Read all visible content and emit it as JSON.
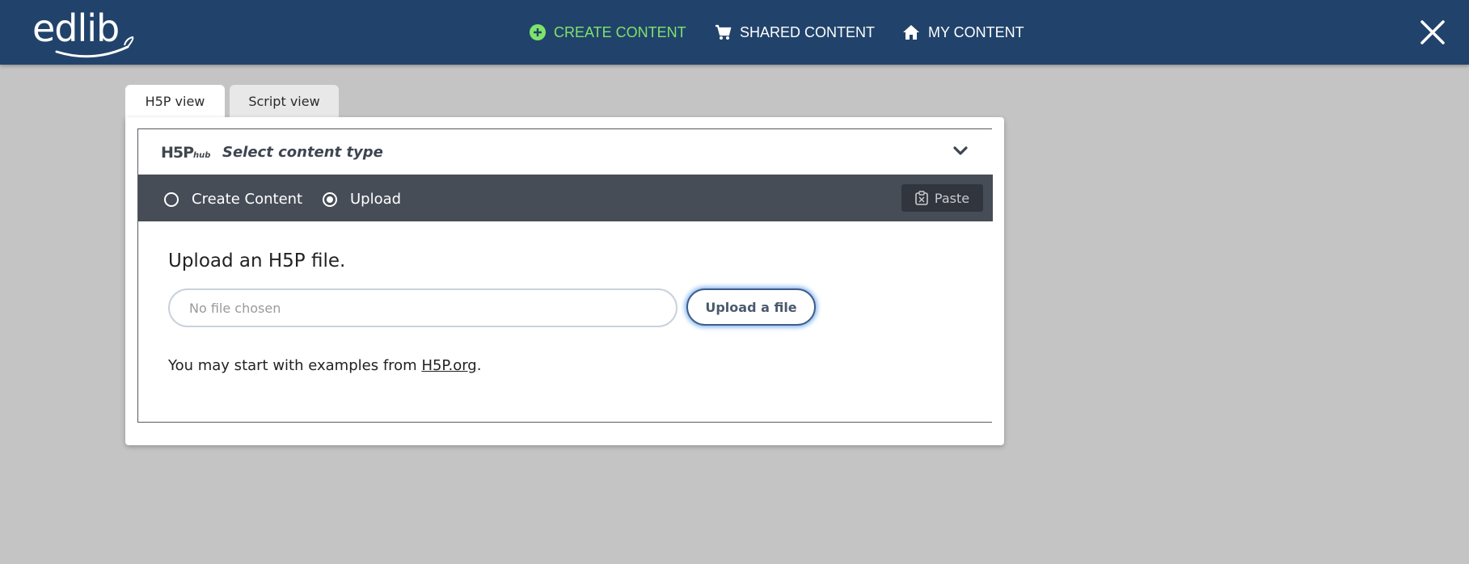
{
  "topbar": {
    "logo_text": "edlib",
    "nav": [
      {
        "label": "CREATE CONTENT",
        "icon": "plus-circle-icon",
        "color": "#7ee36b"
      },
      {
        "label": "SHARED CONTENT",
        "icon": "cart-icon",
        "color": "#ffffff"
      },
      {
        "label": "MY CONTENT",
        "icon": "home-icon",
        "color": "#ffffff"
      }
    ],
    "close_icon": "close-icon",
    "background": "#21436b"
  },
  "tabs": [
    {
      "label": "H5P view",
      "active": true
    },
    {
      "label": "Script view",
      "active": false
    }
  ],
  "hub": {
    "logo": "H5P",
    "logo_suffix": "hub",
    "title": "Select content type",
    "options": [
      {
        "label": "Create Content",
        "checked": false
      },
      {
        "label": "Upload",
        "checked": true
      }
    ],
    "paste_label": "Paste",
    "bar_color": "#474d57"
  },
  "upload": {
    "title": "Upload an H5P file.",
    "file_placeholder": "No file chosen",
    "button_label": "Upload a file",
    "examples_prefix": "You may start with examples from ",
    "examples_link": "H5P.org",
    "examples_suffix": "."
  }
}
